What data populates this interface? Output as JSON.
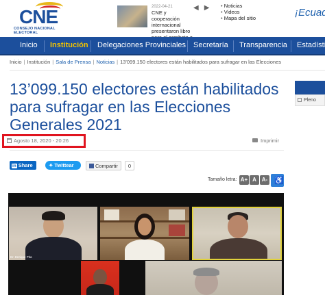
{
  "header": {
    "logo": {
      "text": "CNE",
      "subtitle": "CONSEJO NACIONAL ELECTORAL"
    },
    "news": {
      "date": "2022-04-21",
      "text": "CNE y cooperación internacional presentaron libro para el combate a la..."
    },
    "quick_links": [
      "Noticias",
      "Videos",
      "Mapa del sitio"
    ],
    "country_text": "¡Ecuado"
  },
  "nav": {
    "items": [
      "Inicio",
      "Institución",
      "Delegaciones Provinciales",
      "Secretaría",
      "Transparencia",
      "Estadísticas"
    ],
    "active_index": 1
  },
  "breadcrumb": [
    "Inicio",
    "Institución",
    "Sala de Prensa",
    "Noticias",
    "13'099.150 electores están habilitados para sufragar en las Elecciones"
  ],
  "article": {
    "title": "13’099.150 electores están habilitados para sufragar en las Elecciones Generales 2021",
    "date": "Agosto 18, 2020 - 20:26",
    "print_label": "Imprimir"
  },
  "sidebar": {
    "plenary_label": "Pleno"
  },
  "share": {
    "linkedin_label": "Share",
    "linkedin_badge": "in",
    "twitter_label": "Twittear",
    "facebook_label": "Compartir",
    "facebook_count": "0"
  },
  "text_size": {
    "label": "Tamaño letra:",
    "buttons": [
      "A+",
      "A",
      "A-"
    ]
  },
  "video": {
    "label1": "Dr. Enrique Pita"
  },
  "colors": {
    "brand_blue": "#1c4f9c",
    "nav_active": "#f2c300",
    "highlight_red": "#e0141f"
  }
}
